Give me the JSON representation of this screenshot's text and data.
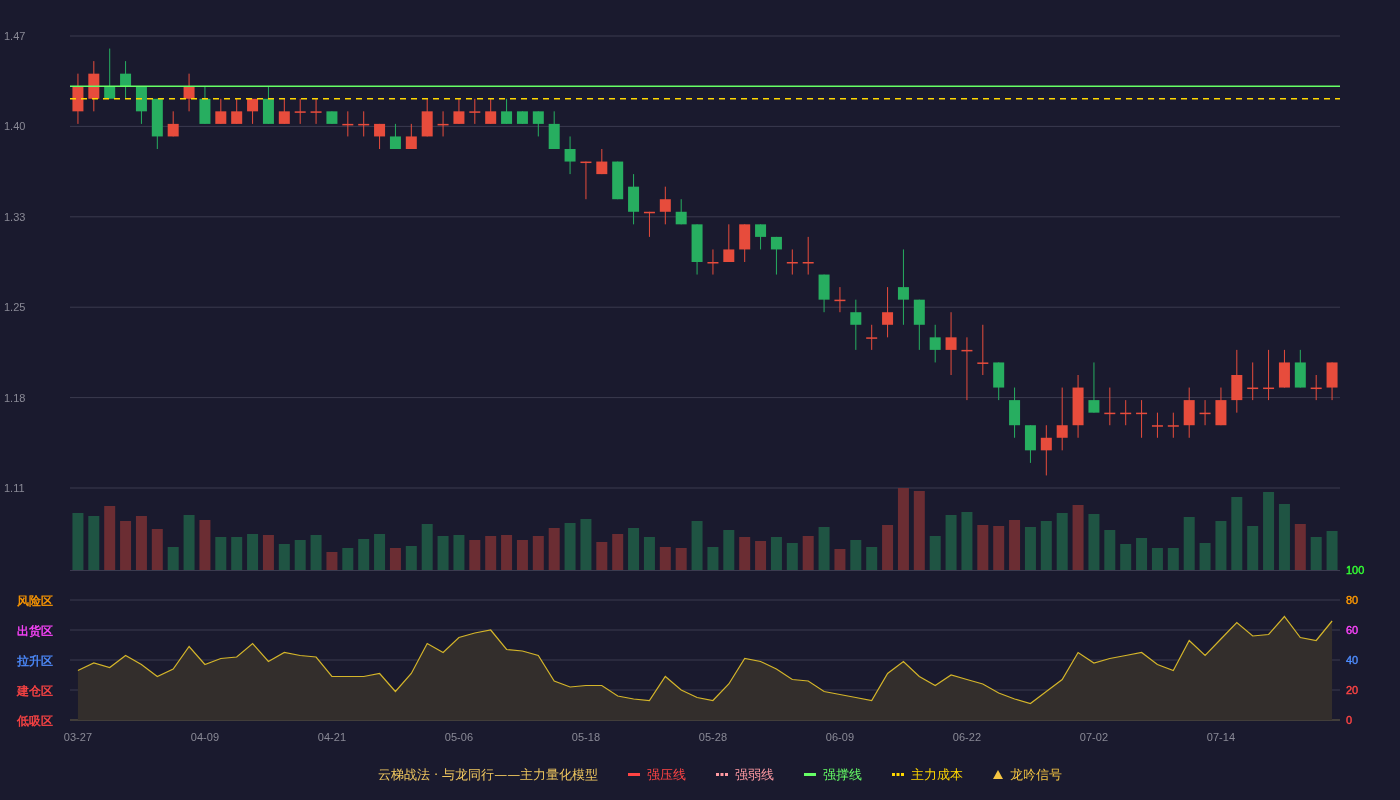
{
  "price_chart": {
    "chart_data": {
      "type": "candlestick",
      "ylim": [
        1.11,
        1.47
      ],
      "yticks": [
        {
          "value": 1.11,
          "label": "1.11"
        },
        {
          "value": 1.182,
          "label": "1.18"
        },
        {
          "value": 1.254,
          "label": "1.25"
        },
        {
          "value": 1.326,
          "label": "1.33"
        },
        {
          "value": 1.398,
          "label": "1.40"
        },
        {
          "value": 1.47,
          "label": "1.47"
        }
      ],
      "categories": [
        null,
        null,
        null,
        null,
        null,
        null,
        null,
        null,
        null,
        null,
        null,
        null,
        null,
        null,
        null,
        null,
        null,
        null,
        null,
        null,
        null,
        null,
        null,
        null,
        null,
        null,
        null,
        null,
        null,
        null,
        null,
        null,
        null,
        null,
        null,
        null,
        null,
        null,
        null,
        null,
        null,
        null,
        null,
        null,
        null,
        null,
        null,
        null,
        null,
        null,
        null,
        null,
        null,
        null,
        null,
        null,
        null,
        null,
        null,
        null,
        null,
        null,
        null,
        null,
        null,
        null,
        null,
        null,
        null,
        null,
        null,
        null,
        null,
        null,
        null,
        null,
        null,
        null,
        null,
        null
      ],
      "grid": true,
      "ohlc": [
        [
          1.41,
          1.44,
          1.4,
          1.43
        ],
        [
          1.42,
          1.45,
          1.41,
          1.44
        ],
        [
          1.43,
          1.46,
          1.42,
          1.42
        ],
        [
          1.44,
          1.45,
          1.42,
          1.43
        ],
        [
          1.43,
          1.43,
          1.4,
          1.41
        ],
        [
          1.42,
          1.42,
          1.38,
          1.39
        ],
        [
          1.39,
          1.41,
          1.39,
          1.4
        ],
        [
          1.42,
          1.44,
          1.41,
          1.43
        ],
        [
          1.42,
          1.43,
          1.4,
          1.4
        ],
        [
          1.4,
          1.42,
          1.4,
          1.41
        ],
        [
          1.4,
          1.42,
          1.4,
          1.41
        ],
        [
          1.41,
          1.42,
          1.4,
          1.42
        ],
        [
          1.42,
          1.43,
          1.4,
          1.4
        ],
        [
          1.4,
          1.42,
          1.4,
          1.41
        ],
        [
          1.41,
          1.42,
          1.4,
          1.41
        ],
        [
          1.41,
          1.42,
          1.4,
          1.41
        ],
        [
          1.41,
          1.41,
          1.4,
          1.4
        ],
        [
          1.4,
          1.41,
          1.39,
          1.4
        ],
        [
          1.4,
          1.41,
          1.39,
          1.4
        ],
        [
          1.39,
          1.4,
          1.38,
          1.4
        ],
        [
          1.39,
          1.4,
          1.38,
          1.38
        ],
        [
          1.38,
          1.4,
          1.38,
          1.39
        ],
        [
          1.39,
          1.42,
          1.39,
          1.41
        ],
        [
          1.4,
          1.41,
          1.39,
          1.4
        ],
        [
          1.4,
          1.42,
          1.4,
          1.41
        ],
        [
          1.41,
          1.42,
          1.4,
          1.41
        ],
        [
          1.4,
          1.42,
          1.4,
          1.41
        ],
        [
          1.41,
          1.42,
          1.4,
          1.4
        ],
        [
          1.41,
          1.41,
          1.4,
          1.4
        ],
        [
          1.41,
          1.41,
          1.39,
          1.4
        ],
        [
          1.4,
          1.41,
          1.38,
          1.38
        ],
        [
          1.38,
          1.39,
          1.36,
          1.37
        ],
        [
          1.37,
          1.37,
          1.34,
          1.37
        ],
        [
          1.36,
          1.38,
          1.36,
          1.37
        ],
        [
          1.37,
          1.37,
          1.34,
          1.34
        ],
        [
          1.35,
          1.36,
          1.32,
          1.33
        ],
        [
          1.33,
          1.33,
          1.31,
          1.33
        ],
        [
          1.33,
          1.35,
          1.32,
          1.34
        ],
        [
          1.33,
          1.34,
          1.32,
          1.32
        ],
        [
          1.32,
          1.32,
          1.28,
          1.29
        ],
        [
          1.29,
          1.3,
          1.28,
          1.29
        ],
        [
          1.29,
          1.32,
          1.29,
          1.3
        ],
        [
          1.3,
          1.32,
          1.29,
          1.32
        ],
        [
          1.32,
          1.32,
          1.3,
          1.31
        ],
        [
          1.31,
          1.31,
          1.28,
          1.3
        ],
        [
          1.29,
          1.3,
          1.28,
          1.29
        ],
        [
          1.29,
          1.31,
          1.28,
          1.29
        ],
        [
          1.28,
          1.28,
          1.25,
          1.26
        ],
        [
          1.26,
          1.27,
          1.25,
          1.26
        ],
        [
          1.25,
          1.26,
          1.22,
          1.24
        ],
        [
          1.23,
          1.24,
          1.22,
          1.23
        ],
        [
          1.24,
          1.27,
          1.23,
          1.25
        ],
        [
          1.27,
          1.3,
          1.24,
          1.26
        ],
        [
          1.26,
          1.26,
          1.22,
          1.24
        ],
        [
          1.23,
          1.24,
          1.21,
          1.22
        ],
        [
          1.22,
          1.25,
          1.2,
          1.23
        ],
        [
          1.22,
          1.23,
          1.18,
          1.22
        ],
        [
          1.21,
          1.24,
          1.2,
          1.21
        ],
        [
          1.21,
          1.21,
          1.18,
          1.19
        ],
        [
          1.18,
          1.19,
          1.15,
          1.16
        ],
        [
          1.16,
          1.16,
          1.13,
          1.14
        ],
        [
          1.14,
          1.16,
          1.12,
          1.15
        ],
        [
          1.15,
          1.19,
          1.14,
          1.16
        ],
        [
          1.16,
          1.2,
          1.15,
          1.19
        ],
        [
          1.18,
          1.21,
          1.17,
          1.17
        ],
        [
          1.17,
          1.19,
          1.16,
          1.17
        ],
        [
          1.17,
          1.18,
          1.16,
          1.17
        ],
        [
          1.17,
          1.18,
          1.15,
          1.17
        ],
        [
          1.16,
          1.17,
          1.15,
          1.16
        ],
        [
          1.16,
          1.17,
          1.15,
          1.16
        ],
        [
          1.16,
          1.19,
          1.15,
          1.18
        ],
        [
          1.17,
          1.18,
          1.16,
          1.17
        ],
        [
          1.16,
          1.19,
          1.16,
          1.18
        ],
        [
          1.18,
          1.22,
          1.17,
          1.2
        ],
        [
          1.19,
          1.21,
          1.18,
          1.19
        ],
        [
          1.19,
          1.22,
          1.18,
          1.19
        ],
        [
          1.19,
          1.22,
          1.19,
          1.21
        ],
        [
          1.21,
          1.22,
          1.19,
          1.19
        ],
        [
          1.19,
          1.2,
          1.18,
          1.19
        ],
        [
          1.19,
          1.21,
          1.18,
          1.21
        ]
      ],
      "ref_lines": [
        {
          "axis": "y",
          "value": 1.43,
          "color": "#66ff66"
        },
        {
          "axis": "y",
          "value": 1.42,
          "color": "#ffd700"
        }
      ]
    }
  },
  "indicator": {
    "zones": [
      {
        "label": "风险区",
        "color": "#ff9900"
      },
      {
        "label": "出货区",
        "color": "#ff44ff"
      },
      {
        "label": "拉升区",
        "color": "#4d8cff"
      },
      {
        "label": "建仓区",
        "color": "#ff4444"
      },
      {
        "label": "低吸区",
        "color": "#ff4444"
      }
    ],
    "right_axis": [
      {
        "label": "100",
        "color": "#33ff33"
      },
      {
        "label": "80",
        "color": "#ff9900"
      },
      {
        "label": "60",
        "color": "#ff44ff"
      },
      {
        "label": "40",
        "color": "#4d8cff"
      },
      {
        "label": "20",
        "color": "#ff4444"
      },
      {
        "label": "0",
        "color": "#ff4444"
      }
    ],
    "chart_data": {
      "type": "area",
      "ylim": [
        0,
        100
      ],
      "yticks": [
        100,
        80,
        60,
        40,
        20,
        0
      ],
      "grid": true,
      "categories": [
        "03-27",
        null,
        null,
        null,
        null,
        null,
        null,
        null,
        "04-09",
        null,
        null,
        null,
        null,
        null,
        null,
        null,
        "04-21",
        null,
        null,
        null,
        null,
        null,
        null,
        null,
        "05-06",
        null,
        null,
        null,
        null,
        null,
        null,
        null,
        "05-18",
        null,
        null,
        null,
        null,
        null,
        null,
        null,
        "05-28",
        null,
        null,
        null,
        null,
        null,
        null,
        null,
        "06-09",
        null,
        null,
        null,
        null,
        null,
        null,
        null,
        "06-22",
        null,
        null,
        null,
        null,
        null,
        null,
        null,
        "07-02",
        null,
        null,
        null,
        null,
        null,
        null,
        null,
        "07-14",
        null,
        null,
        null,
        null,
        null,
        null,
        null
      ],
      "series": [
        {
          "color": "#d4b52a",
          "values": [
            33,
            38,
            35,
            43,
            37,
            29,
            34,
            49,
            37,
            41,
            42,
            51,
            39,
            45,
            43,
            42,
            29,
            29,
            29,
            31,
            19,
            31,
            51,
            45,
            55,
            58,
            60,
            47,
            46,
            43,
            26,
            22,
            23,
            23,
            16,
            14,
            13,
            29,
            20,
            15,
            13,
            24,
            41,
            39,
            34,
            27,
            26,
            19,
            17,
            15,
            13,
            31,
            39,
            29,
            23,
            30,
            27,
            24,
            18,
            14,
            11,
            19,
            27,
            45,
            38,
            41,
            43,
            45,
            37,
            33,
            53,
            43,
            54,
            65,
            56,
            57,
            69,
            55,
            53,
            66
          ]
        }
      ]
    }
  },
  "legend": {
    "title": "云梯战法 · 与龙同行——主力量化模型",
    "items": [
      {
        "label": "强压线",
        "kind": "solid",
        "color": "#ff4444"
      },
      {
        "label": "强弱线",
        "kind": "dashed",
        "color": "#ff9aa2"
      },
      {
        "label": "强撑线",
        "kind": "solid",
        "color": "#66ff66"
      },
      {
        "label": "主力成本",
        "kind": "dashed",
        "color": "#ffd700"
      },
      {
        "label": "龙吟信号",
        "kind": "triangle",
        "color": "#f5c542"
      }
    ]
  }
}
